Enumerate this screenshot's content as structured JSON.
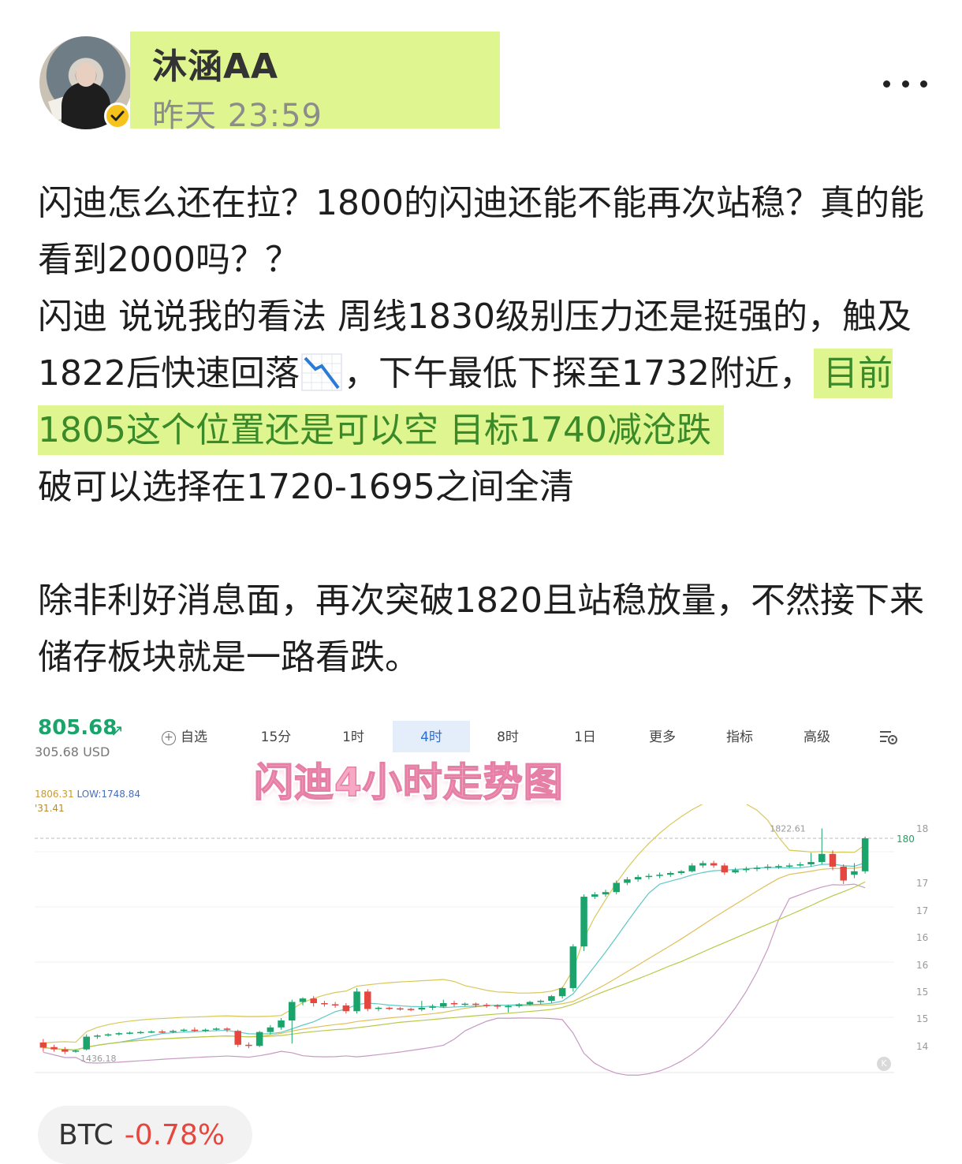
{
  "post": {
    "author": "沐涵AA",
    "time": "昨天 23:59",
    "paragraphs": {
      "p1": "闪迪怎么还在拉？1800的闪迪还能不能再次站稳？真的能看到2000吗？？",
      "p2_a": "闪迪 说说我的看法 周线1830级别压力还是挺强的，触及1822后快速回落",
      "p2_b": "，下午最低下探至1732附近，",
      "p2_highlight": "目前1805这个位置还是可以空 目标1740减沧跌",
      "p2_c": "破可以选择在1720-1695之间全清",
      "p3": "除非利好消息面，再次突破1820且站稳放量，不然接下来储存板块就是一路看跌。"
    },
    "icons": {
      "avatar": "author-avatar",
      "verified": "verified-badge-icon",
      "more": "more-options-icon",
      "trend": "chart-decreasing-emoji"
    }
  },
  "chart": {
    "price": "805.68",
    "price_arrow": "↗",
    "price_usd": "305.68 USD",
    "high_text": "1806.31",
    "low_text": "LOW:1748.84",
    "ma_text": "'31.41",
    "watch_label": "自选",
    "tabs": [
      "15分",
      "1时",
      "4时",
      "8时",
      "1日",
      "更多",
      "指标",
      "高级"
    ],
    "active_tab": "4时",
    "overlay_title": "闪迪4小时走势图",
    "max_label": "1822.61",
    "min_label": "1436.18",
    "last_price_label": "180",
    "k_badge": "K",
    "y_ticks": [
      "18",
      "17",
      "17",
      "16",
      "16",
      "15",
      "15",
      "14"
    ],
    "colors": {
      "up": "#1aa36b",
      "down": "#e5473f",
      "tab_active": "#2d6ed6"
    }
  },
  "chart_data": {
    "type": "candlestick",
    "title": "闪迪4小时走势图",
    "annotations": [
      "1822.61",
      "1436.18"
    ],
    "candles": [
      {
        "o": 1452,
        "c": 1443,
        "h": 1458,
        "l": 1436
      },
      {
        "o": 1444,
        "c": 1440,
        "h": 1448,
        "l": 1436
      },
      {
        "o": 1440,
        "c": 1436,
        "h": 1444,
        "l": 1432
      },
      {
        "o": 1436,
        "c": 1438,
        "h": 1440,
        "l": 1434
      },
      {
        "o": 1440,
        "c": 1462,
        "h": 1466,
        "l": 1438
      },
      {
        "o": 1462,
        "c": 1464,
        "h": 1466,
        "l": 1458
      },
      {
        "o": 1464,
        "c": 1466,
        "h": 1468,
        "l": 1462
      },
      {
        "o": 1466,
        "c": 1468,
        "h": 1470,
        "l": 1464
      },
      {
        "o": 1468,
        "c": 1469,
        "h": 1471,
        "l": 1466
      },
      {
        "o": 1469,
        "c": 1470,
        "h": 1472,
        "l": 1467
      },
      {
        "o": 1470,
        "c": 1471,
        "h": 1473,
        "l": 1468
      },
      {
        "o": 1471,
        "c": 1470,
        "h": 1474,
        "l": 1468
      },
      {
        "o": 1470,
        "c": 1472,
        "h": 1474,
        "l": 1468
      },
      {
        "o": 1472,
        "c": 1474,
        "h": 1476,
        "l": 1470
      },
      {
        "o": 1474,
        "c": 1472,
        "h": 1478,
        "l": 1470
      },
      {
        "o": 1472,
        "c": 1474,
        "h": 1476,
        "l": 1470
      },
      {
        "o": 1474,
        "c": 1476,
        "h": 1478,
        "l": 1472
      },
      {
        "o": 1476,
        "c": 1474,
        "h": 1478,
        "l": 1470
      },
      {
        "o": 1472,
        "c": 1448,
        "h": 1474,
        "l": 1444
      },
      {
        "o": 1448,
        "c": 1446,
        "h": 1452,
        "l": 1442
      },
      {
        "o": 1446,
        "c": 1470,
        "h": 1472,
        "l": 1444
      },
      {
        "o": 1470,
        "c": 1478,
        "h": 1482,
        "l": 1466
      },
      {
        "o": 1478,
        "c": 1490,
        "h": 1494,
        "l": 1474
      },
      {
        "o": 1490,
        "c": 1522,
        "h": 1526,
        "l": 1450
      },
      {
        "o": 1522,
        "c": 1528,
        "h": 1530,
        "l": 1516
      },
      {
        "o": 1528,
        "c": 1520,
        "h": 1532,
        "l": 1514
      },
      {
        "o": 1520,
        "c": 1518,
        "h": 1524,
        "l": 1514
      },
      {
        "o": 1518,
        "c": 1516,
        "h": 1522,
        "l": 1512
      },
      {
        "o": 1516,
        "c": 1506,
        "h": 1520,
        "l": 1502
      },
      {
        "o": 1506,
        "c": 1540,
        "h": 1546,
        "l": 1502
      },
      {
        "o": 1540,
        "c": 1510,
        "h": 1544,
        "l": 1506
      },
      {
        "o": 1510,
        "c": 1512,
        "h": 1514,
        "l": 1506
      },
      {
        "o": 1512,
        "c": 1511,
        "h": 1514,
        "l": 1508
      },
      {
        "o": 1511,
        "c": 1510,
        "h": 1513,
        "l": 1507
      },
      {
        "o": 1510,
        "c": 1509,
        "h": 1512,
        "l": 1506
      },
      {
        "o": 1509,
        "c": 1512,
        "h": 1524,
        "l": 1506
      },
      {
        "o": 1512,
        "c": 1514,
        "h": 1518,
        "l": 1508
      },
      {
        "o": 1514,
        "c": 1520,
        "h": 1526,
        "l": 1512
      },
      {
        "o": 1520,
        "c": 1518,
        "h": 1524,
        "l": 1514
      },
      {
        "o": 1518,
        "c": 1519,
        "h": 1521,
        "l": 1515
      },
      {
        "o": 1519,
        "c": 1517,
        "h": 1521,
        "l": 1513
      },
      {
        "o": 1517,
        "c": 1516,
        "h": 1520,
        "l": 1512
      },
      {
        "o": 1516,
        "c": 1514,
        "h": 1518,
        "l": 1510
      },
      {
        "o": 1514,
        "c": 1515,
        "h": 1517,
        "l": 1504
      },
      {
        "o": 1515,
        "c": 1518,
        "h": 1520,
        "l": 1512
      },
      {
        "o": 1518,
        "c": 1522,
        "h": 1524,
        "l": 1516
      },
      {
        "o": 1522,
        "c": 1524,
        "h": 1526,
        "l": 1518
      },
      {
        "o": 1524,
        "c": 1532,
        "h": 1534,
        "l": 1520
      },
      {
        "o": 1532,
        "c": 1546,
        "h": 1548,
        "l": 1528
      },
      {
        "o": 1546,
        "c": 1618,
        "h": 1622,
        "l": 1540
      },
      {
        "o": 1618,
        "c": 1704,
        "h": 1708,
        "l": 1610
      },
      {
        "o": 1704,
        "c": 1708,
        "h": 1712,
        "l": 1700
      },
      {
        "o": 1708,
        "c": 1712,
        "h": 1716,
        "l": 1704
      },
      {
        "o": 1712,
        "c": 1728,
        "h": 1732,
        "l": 1708
      },
      {
        "o": 1728,
        "c": 1734,
        "h": 1738,
        "l": 1724
      },
      {
        "o": 1734,
        "c": 1738,
        "h": 1742,
        "l": 1730
      },
      {
        "o": 1738,
        "c": 1740,
        "h": 1744,
        "l": 1734
      },
      {
        "o": 1740,
        "c": 1742,
        "h": 1746,
        "l": 1736
      },
      {
        "o": 1742,
        "c": 1745,
        "h": 1748,
        "l": 1738
      },
      {
        "o": 1745,
        "c": 1748,
        "h": 1750,
        "l": 1742
      },
      {
        "o": 1748,
        "c": 1758,
        "h": 1762,
        "l": 1746
      },
      {
        "o": 1758,
        "c": 1762,
        "h": 1766,
        "l": 1754
      },
      {
        "o": 1762,
        "c": 1758,
        "h": 1766,
        "l": 1754
      },
      {
        "o": 1758,
        "c": 1746,
        "h": 1762,
        "l": 1742
      },
      {
        "o": 1746,
        "c": 1750,
        "h": 1754,
        "l": 1744
      },
      {
        "o": 1750,
        "c": 1752,
        "h": 1756,
        "l": 1746
      },
      {
        "o": 1752,
        "c": 1754,
        "h": 1758,
        "l": 1748
      },
      {
        "o": 1754,
        "c": 1756,
        "h": 1760,
        "l": 1750
      },
      {
        "o": 1756,
        "c": 1757,
        "h": 1760,
        "l": 1752
      },
      {
        "o": 1757,
        "c": 1758,
        "h": 1762,
        "l": 1754
      },
      {
        "o": 1758,
        "c": 1760,
        "h": 1764,
        "l": 1755
      },
      {
        "o": 1760,
        "c": 1764,
        "h": 1780,
        "l": 1756
      },
      {
        "o": 1764,
        "c": 1778,
        "h": 1822,
        "l": 1760
      },
      {
        "o": 1778,
        "c": 1756,
        "h": 1784,
        "l": 1750
      },
      {
        "o": 1756,
        "c": 1732,
        "h": 1760,
        "l": 1726
      },
      {
        "o": 1742,
        "c": 1748,
        "h": 1762,
        "l": 1736
      },
      {
        "o": 1748,
        "c": 1805,
        "h": 1808,
        "l": 1744
      }
    ],
    "indicator_lines": [
      "upper-band",
      "middle-band",
      "lower-band",
      "ma-short",
      "ma-long"
    ],
    "ylim": [
      1400,
      1850
    ],
    "reference_line": 1805
  },
  "footer": {
    "ticker_symbol": "BTC",
    "ticker_change": "-0.78%"
  }
}
